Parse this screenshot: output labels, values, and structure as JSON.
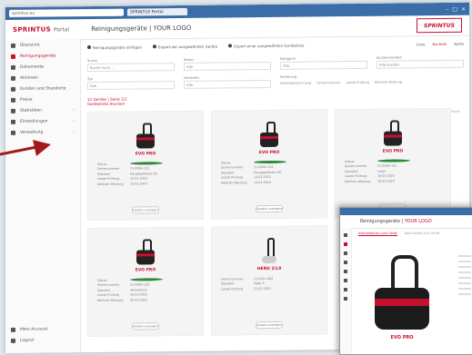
{
  "browser": {
    "address": "sprintus.eu",
    "tab": "SPRINTUS Portal"
  },
  "header": {
    "logo": "SPRINTUS",
    "portal": "Portal",
    "title": "Reinigungsgeräte | YOUR LOGO",
    "brand_badge": "SPRINTUS"
  },
  "sidebar": {
    "items": [
      {
        "label": "Übersicht"
      },
      {
        "label": "Reinigungsgeräte"
      },
      {
        "label": "Dokumente"
      },
      {
        "label": "Aktionen"
      },
      {
        "label": "Kunden und Standorte"
      },
      {
        "label": "Preise"
      },
      {
        "label": "Statistiken"
      },
      {
        "label": "Einstellungen"
      },
      {
        "label": "Verwaltung"
      }
    ],
    "bottom": [
      {
        "label": "Mein Account"
      },
      {
        "label": "Logout"
      }
    ]
  },
  "toolbar": {
    "items": [
      "Reinigungsgeräte einfügen",
      "Export der ausgewählten Geräte",
      "Export einer ausgewählten Geräteliste"
    ],
    "right": [
      "Liste",
      "Kacheln",
      "Karte"
    ]
  },
  "filters": [
    {
      "label": "Suche",
      "value": "Suche nach ..."
    },
    {
      "label": "Status",
      "value": "Alle"
    },
    {
      "label": "Kategorie",
      "value": "Alle"
    },
    {
      "label": "Kundenstandort",
      "value": "Alle Kunden"
    },
    {
      "label": "Typ",
      "value": "Alle"
    },
    {
      "label": "Hersteller",
      "value": "Alle"
    }
  ],
  "sorting": {
    "label": "Sortierung",
    "options": [
      "Gerätebezeichnung",
      "Seriennummer",
      "Letzte Prüfung",
      "Nächste Wartung"
    ]
  },
  "results": {
    "count": "12 Geräte | Seite 1/2",
    "link": "Geräteliste drucken",
    "right": "Filter zurücksetzen"
  },
  "labels": {
    "status": "Status",
    "serial": "Seriennummer",
    "location": "Standort",
    "last": "Letzte Prüfung",
    "next": "Nächste Wartung",
    "button": "Details anzeigen"
  },
  "cards": [
    {
      "name": "EVO PRO",
      "serial": "21-0004-123",
      "location": "Hauptgebäude EG",
      "last": "12.03.2023",
      "next": "12.03.2024"
    },
    {
      "name": "EVO PRO",
      "serial": "21-0004-124",
      "location": "Hauptgebäude OG",
      "last": "14.03.2023",
      "next": "14.03.2024"
    },
    {
      "name": "EVO PRO",
      "serial": "21-0004-125",
      "location": "Lager",
      "last": "18.03.2023",
      "next": "18.03.2024"
    },
    {
      "name": "EVO PRO",
      "serial": "21-0004-126",
      "location": "Verwaltung",
      "last": "20.03.2023",
      "next": "20.03.2024"
    },
    {
      "name": "HERO 2/L9",
      "serial": "21-0011-002",
      "location": "Halle 3",
      "last": "22.03.2023",
      "next": "22.03.2024"
    }
  ],
  "inset": {
    "title_pre": "Reinigungsgeräte | ",
    "title_logo": "YOUR LOGO",
    "tabs": [
      "Informationen zum Gerät",
      "Dokumente zum Gerät"
    ],
    "product": "EVO PRO"
  },
  "colors": {
    "brand": "#c8102e",
    "chrome": "#3b6ea8",
    "status_ok": "#2a8a3a"
  }
}
